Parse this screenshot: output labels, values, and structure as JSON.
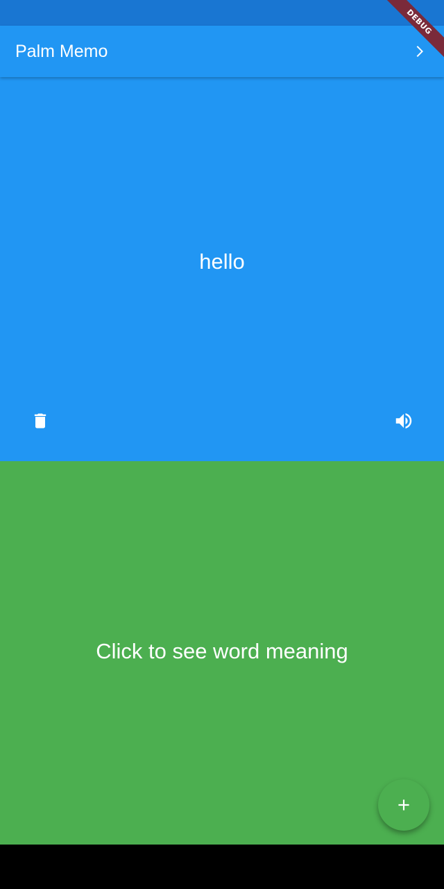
{
  "colors": {
    "status_bar": "#1976D2",
    "app_bar": "#2196F3",
    "word_card": "#2196F3",
    "meaning_card": "#4CAF50",
    "fab": "#4CAF50",
    "nav_bar": "#000000",
    "debug_ribbon": "#7A2A3A",
    "foreground": "#FFFFFF"
  },
  "app_bar": {
    "title": "Palm Memo",
    "next_icon": "chevron-right-icon"
  },
  "word_card": {
    "word": "hello",
    "delete_icon": "trash-icon",
    "speak_icon": "volume-up-icon"
  },
  "meaning_card": {
    "prompt": "Click to see word meaning"
  },
  "fab": {
    "icon": "plus-icon"
  },
  "debug_banner": {
    "label": "DEBUG"
  }
}
